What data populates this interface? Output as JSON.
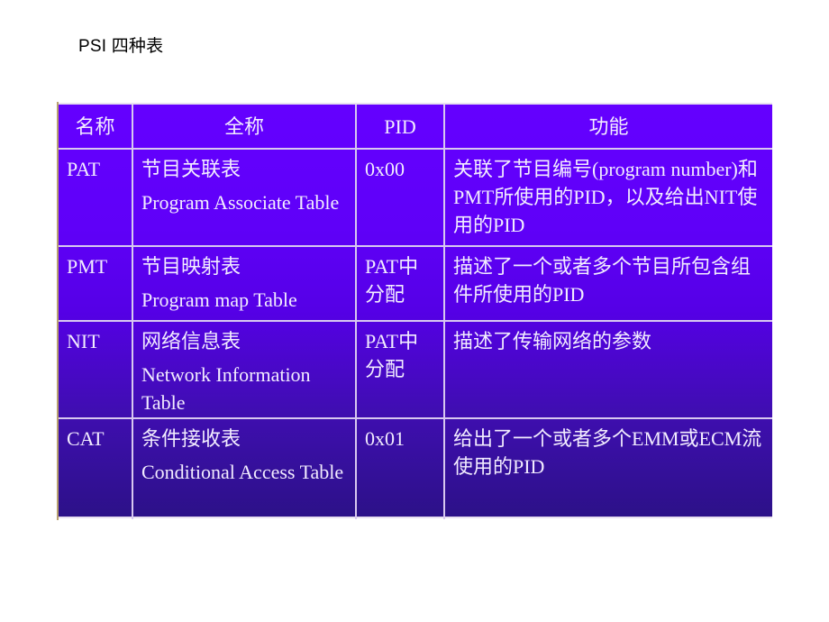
{
  "title": "PSI 四种表",
  "table": {
    "headers": [
      "名称",
      "全称",
      "PID",
      "功能"
    ],
    "rows": [
      {
        "name": "PAT",
        "full_cn": "节目关联表",
        "full_en": "Program Associate Table",
        "pid": "0x00",
        "function": "关联了节目编号(program number)和PMT所使用的PID，以及给出NIT使用的PID"
      },
      {
        "name": "PMT",
        "full_cn": "节目映射表",
        "full_en": "Program map Table",
        "pid": "PAT中分配",
        "function": "描述了一个或者多个节目所包含组件所使用的PID"
      },
      {
        "name": "NIT",
        "full_cn": "网络信息表",
        "full_en": "Network Information Table",
        "pid": "PAT中分配",
        "function": "描述了传输网络的参数"
      },
      {
        "name": "CAT",
        "full_cn": "条件接收表",
        "full_en": "Conditional Access Table",
        "pid": "0x01",
        "function": "给出了一个或者多个EMM或ECM流使用的PID"
      }
    ]
  }
}
